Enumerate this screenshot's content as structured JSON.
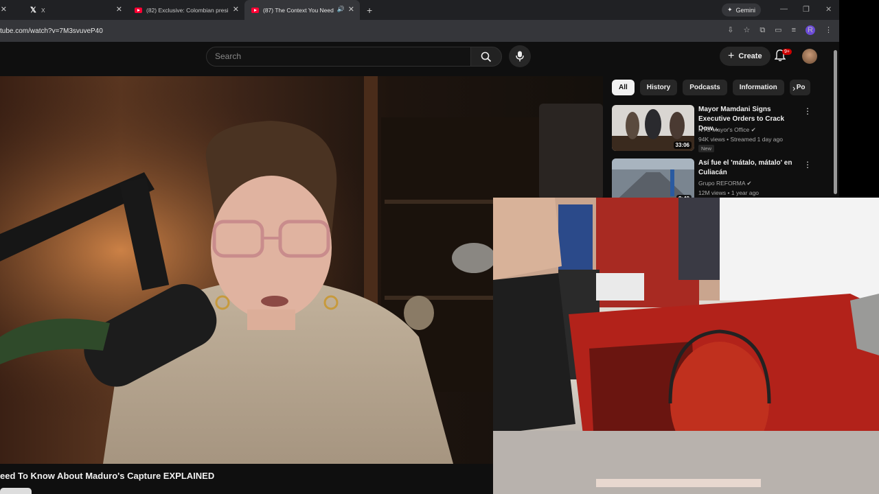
{
  "browser": {
    "tabs": [
      {
        "label": "X",
        "active": false
      },
      {
        "label": "(82) Exclusive: Colombian presi",
        "active": false
      },
      {
        "label": "(87) The Context You Need",
        "active": true
      }
    ],
    "new_tab": "+",
    "gemini_label": "Gemini",
    "url": "tube.com/watch?v=7M3svuveP40",
    "profile_initial": "R"
  },
  "youtube": {
    "search_placeholder": "Search",
    "create_label": "Create",
    "notification_count": "9+",
    "video_title": "eed To Know About Maduro's Capture EXPLAINED",
    "chips": [
      "All",
      "History",
      "Podcasts",
      "Information",
      "Po"
    ],
    "recommendations": [
      {
        "title": "Mayor Mamdani Signs Executive Orders to Crack Dow...",
        "channel": "NYC Mayor's Office",
        "meta": "94K views • Streamed 1 day ago",
        "badge": "New",
        "duration": "33:06"
      },
      {
        "title": "Así fue el 'mátalo, mátalo' en Culiacán",
        "channel": "Grupo REFORMA",
        "meta": "12M views • 1 year ago",
        "badge": "",
        "duration": "8:40"
      }
    ]
  },
  "colors": {
    "youtube_red": "#ff0033",
    "page_bg": "#0f0f0f",
    "chrome_bg": "#202124",
    "chip_active": "#f1f1f1"
  }
}
